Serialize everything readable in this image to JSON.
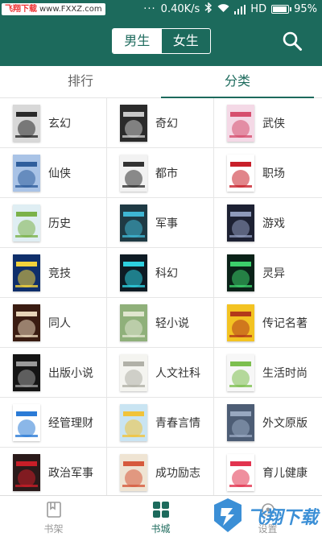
{
  "status_bar": {
    "watermark_brand": "飞翔下载",
    "watermark_url": "www.FXXZ.com",
    "dots": "···",
    "speed": "0.40K/s",
    "network": "HD",
    "battery": "95%",
    "battery_level": 0.95
  },
  "header": {
    "gender_tabs": [
      {
        "label": "男生",
        "active": true
      },
      {
        "label": "女生",
        "active": false
      }
    ],
    "search_icon": "search-icon"
  },
  "tabs": [
    {
      "label": "排行",
      "active": false
    },
    {
      "label": "分类",
      "active": true
    }
  ],
  "categories": [
    {
      "label": "玄幻",
      "cover": [
        "#d8d8d8",
        "#2a2a2a"
      ]
    },
    {
      "label": "奇幻",
      "cover": [
        "#2b2b2b",
        "#c9c9c9"
      ]
    },
    {
      "label": "武侠",
      "cover": [
        "#f4d9e6",
        "#d64f6e"
      ]
    },
    {
      "label": "仙侠",
      "cover": [
        "#a9c3e6",
        "#2f5e9c"
      ]
    },
    {
      "label": "都市",
      "cover": [
        "#f2f2f2",
        "#333333"
      ]
    },
    {
      "label": "职场",
      "cover": [
        "#ffffff",
        "#c8202a"
      ]
    },
    {
      "label": "历史",
      "cover": [
        "#dfeef3",
        "#7bb24a"
      ]
    },
    {
      "label": "军事",
      "cover": [
        "#1f3a44",
        "#3fb6d3"
      ]
    },
    {
      "label": "游戏",
      "cover": [
        "#1d2133",
        "#8e9abb"
      ]
    },
    {
      "label": "竞技",
      "cover": [
        "#0f2f6b",
        "#f2d23c"
      ]
    },
    {
      "label": "科幻",
      "cover": [
        "#0e1b24",
        "#2ed0e0"
      ]
    },
    {
      "label": "灵异",
      "cover": [
        "#0a2218",
        "#3ccf6b"
      ]
    },
    {
      "label": "同人",
      "cover": [
        "#3a1c12",
        "#e7d4b8"
      ]
    },
    {
      "label": "轻小说",
      "cover": [
        "#8fb07a",
        "#e0e6cf"
      ]
    },
    {
      "label": "传记名著",
      "cover": [
        "#f3c322",
        "#b33a1a"
      ]
    },
    {
      "label": "出版小说",
      "cover": [
        "#151515",
        "#9a9a9a"
      ]
    },
    {
      "label": "人文社科",
      "cover": [
        "#f4f4f0",
        "#b1b1a8"
      ]
    },
    {
      "label": "生活时尚",
      "cover": [
        "#f7f7f7",
        "#7dbf4f"
      ]
    },
    {
      "label": "经管理财",
      "cover": [
        "#ffffff",
        "#2b7bd6"
      ]
    },
    {
      "label": "青春言情",
      "cover": [
        "#c9e4f2",
        "#f1c33a"
      ]
    },
    {
      "label": "外文原版",
      "cover": [
        "#4d5d75",
        "#98a8c0"
      ]
    },
    {
      "label": "政治军事",
      "cover": [
        "#2a1a1a",
        "#c81e28"
      ]
    },
    {
      "label": "成功励志",
      "cover": [
        "#efe4d3",
        "#d65a3c"
      ]
    },
    {
      "label": "育儿健康",
      "cover": [
        "#ffffff",
        "#e2334f"
      ]
    }
  ],
  "bottom_nav": [
    {
      "label": "书架",
      "icon": "bookmark-book-icon",
      "active": false
    },
    {
      "label": "书城",
      "icon": "grid-four-icon",
      "active": true
    },
    {
      "label": "设置",
      "icon": "settings-icon",
      "active": false
    }
  ],
  "overlay_watermark": "飞翔下载",
  "colors": {
    "primary": "#1c6a5c",
    "divider": "#e6e6e6",
    "inactive_text": "#999999"
  }
}
